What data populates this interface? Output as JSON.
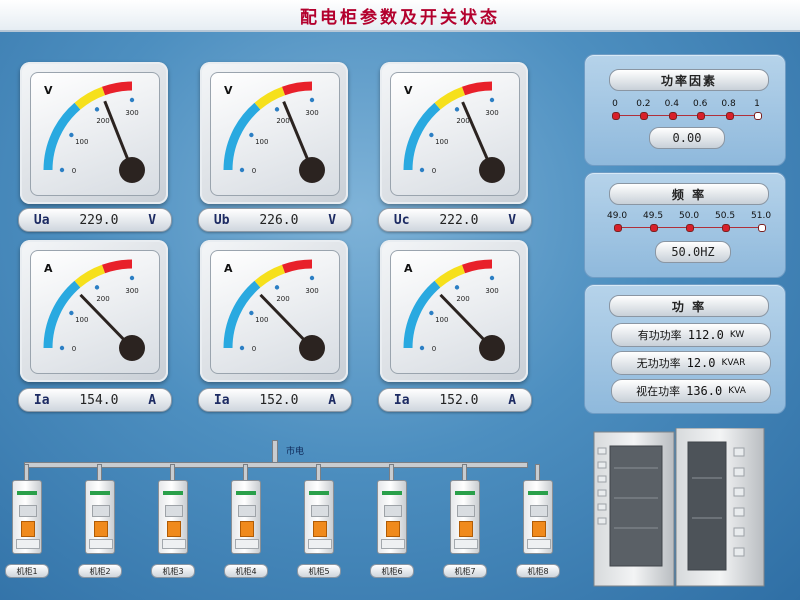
{
  "title": "配电柜参数及开关状态",
  "meters": [
    {
      "unit": "V",
      "scale": [
        "0",
        "100",
        "200",
        "300"
      ],
      "label": "Ua",
      "value": "229.0",
      "value_unit": "V",
      "needle_fraction": 0.76
    },
    {
      "unit": "V",
      "scale": [
        "0",
        "100",
        "200",
        "300"
      ],
      "label": "Ub",
      "value": "226.0",
      "value_unit": "V",
      "needle_fraction": 0.75
    },
    {
      "unit": "V",
      "scale": [
        "0",
        "100",
        "200",
        "300"
      ],
      "label": "Uc",
      "value": "222.0",
      "value_unit": "V",
      "needle_fraction": 0.74
    },
    {
      "unit": "A",
      "scale": [
        "0",
        "100",
        "200",
        "300"
      ],
      "label": "Ia",
      "value": "154.0",
      "value_unit": "A",
      "needle_fraction": 0.51
    },
    {
      "unit": "A",
      "scale": [
        "0",
        "100",
        "200",
        "300"
      ],
      "label": "Ia",
      "value": "152.0",
      "value_unit": "A",
      "needle_fraction": 0.51
    },
    {
      "unit": "A",
      "scale": [
        "0",
        "100",
        "200",
        "300"
      ],
      "label": "Ia",
      "value": "152.0",
      "value_unit": "A",
      "needle_fraction": 0.51
    }
  ],
  "power_factor": {
    "title": "功率因素",
    "scale": [
      "0",
      "0.2",
      "0.4",
      "0.6",
      "0.8",
      "1"
    ],
    "value": "0.00"
  },
  "frequency": {
    "title": "频  率",
    "scale": [
      "49.0",
      "49.5",
      "50.0",
      "50.5",
      "51.0"
    ],
    "value": "50.0HZ"
  },
  "power": {
    "title": "功  率",
    "rows": [
      {
        "label": "有功功率",
        "value": "112.0",
        "unit": "KW"
      },
      {
        "label": "无功功率",
        "value": "12.0",
        "unit": "KVAR"
      },
      {
        "label": "视在功率",
        "value": "136.0",
        "unit": "KVA"
      }
    ]
  },
  "bus_label": "市电",
  "breakers": [
    "机柜1",
    "机柜2",
    "机柜3",
    "机柜4",
    "机柜5",
    "机柜6",
    "机柜7",
    "机柜8"
  ],
  "colors": {
    "title": "#b3002d",
    "arc_blue": "#29a9e0",
    "arc_yellow": "#f6e01c",
    "arc_red": "#e8202a",
    "dot_red": "#d8202a"
  }
}
